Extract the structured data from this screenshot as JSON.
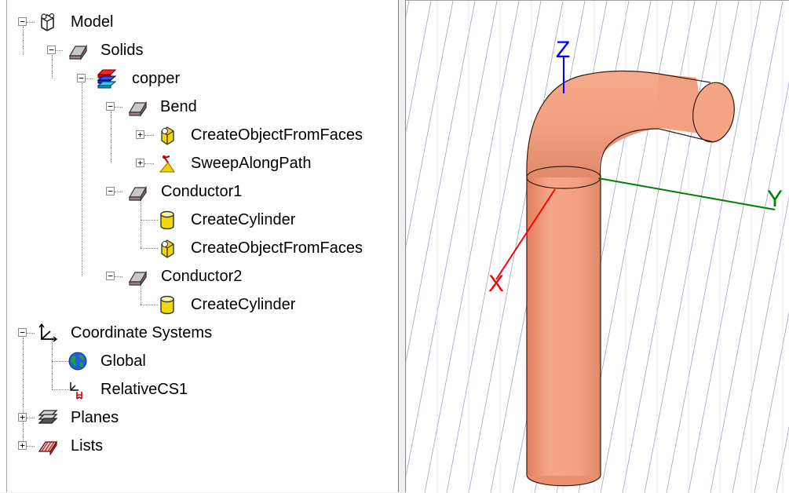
{
  "tree": {
    "model": "Model",
    "solids": "Solids",
    "copper": "copper",
    "bend": "Bend",
    "bend_op1": "CreateObjectFromFaces",
    "bend_op2": "SweepAlongPath",
    "conductor1": "Conductor1",
    "c1_op1": "CreateCylinder",
    "c1_op2": "CreateObjectFromFaces",
    "conductor2": "Conductor2",
    "c2_op1": "CreateCylinder",
    "coordinate_systems": "Coordinate Systems",
    "global": "Global",
    "relative_cs": "RelativeCS1",
    "planes": "Planes",
    "lists": "Lists"
  },
  "viewport": {
    "axis_x": "X",
    "axis_y": "Y",
    "axis_z": "Z",
    "copper_color": "#f2a080",
    "axis_x_color": "#ff0000",
    "axis_y_color": "#008000",
    "axis_z_color": "#0000ff"
  }
}
